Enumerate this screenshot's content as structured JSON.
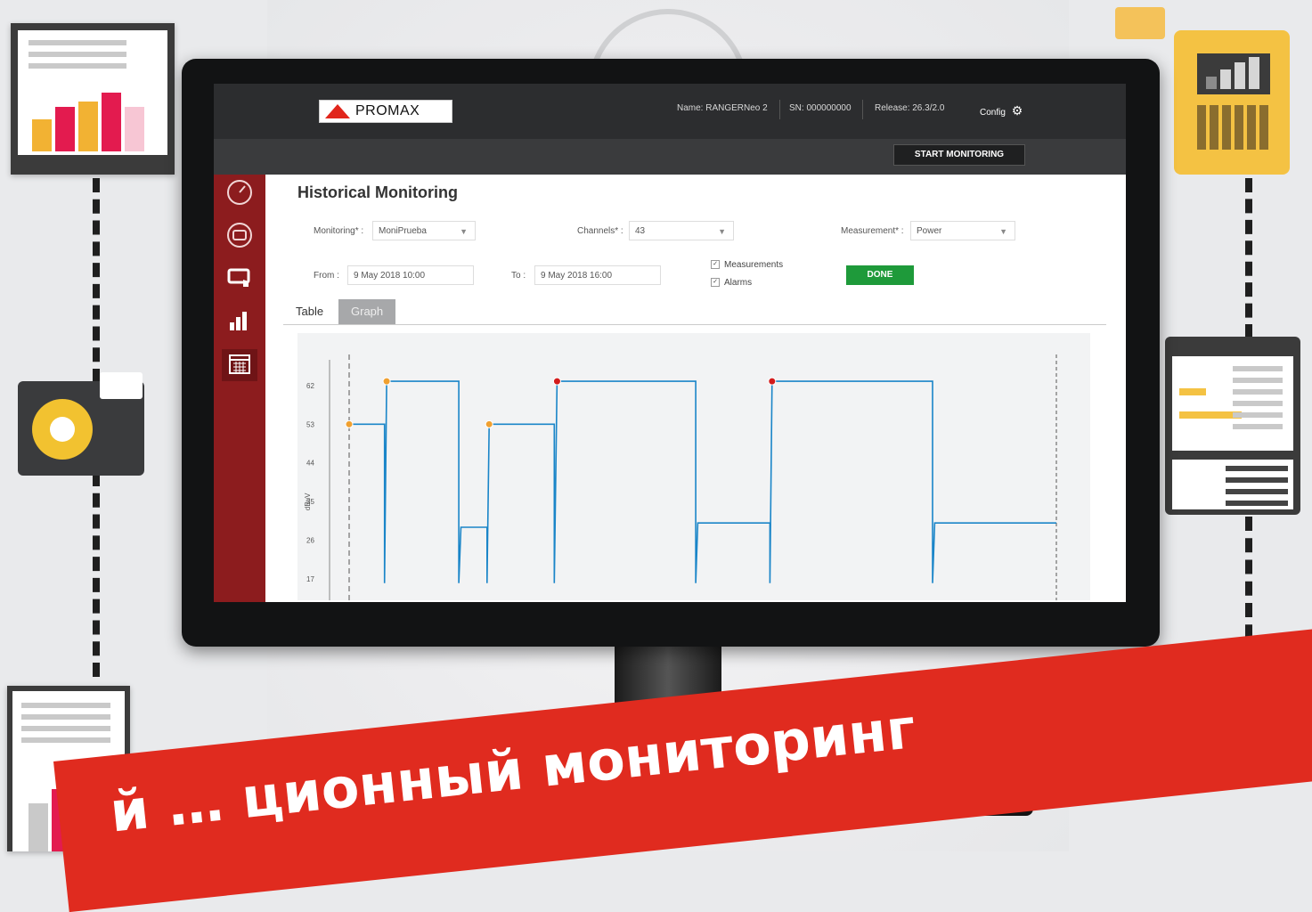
{
  "colors": {
    "brand_red": "#e02b1f",
    "sidebar_red": "#8c1c1e",
    "done_green": "#1e9a3a",
    "trace_blue": "#1a85c8"
  },
  "header": {
    "logo_text": "PROMAX",
    "device_name": "Name: RANGERNeo 2",
    "serial": "SN: 000000000",
    "release": "Release: 26.3/2.0",
    "config_label": "Config",
    "config_icon": "gear-icon"
  },
  "toolbar": {
    "start_monitoring": "START MONITORING"
  },
  "sidebar": {
    "items": [
      {
        "icon": "gauge-icon"
      },
      {
        "icon": "screen-icon"
      },
      {
        "icon": "monitor-touch-icon"
      },
      {
        "icon": "bar-chart-icon"
      },
      {
        "icon": "calendar-icon",
        "active": true
      }
    ]
  },
  "page": {
    "title": "Historical Monitoring"
  },
  "filters": {
    "monitoring_label": "Monitoring* :",
    "monitoring_value": "MoniPrueba",
    "channels_label": "Channels* :",
    "channels_value": "43",
    "measurement_label": "Measurement* :",
    "measurement_value": "Power",
    "from_label": "From :",
    "from_value": "9 May 2018 10:00",
    "to_label": "To :",
    "to_value": "9 May 2018 16:00",
    "measurements_check": "Measurements",
    "alarms_check": "Alarms",
    "done_label": "DONE"
  },
  "tabs": [
    {
      "label": "Table",
      "active": true
    },
    {
      "label": "Graph",
      "active": false
    }
  ],
  "chart_data": {
    "type": "line",
    "ylabel": "dBuV",
    "y_ticks": [
      62,
      53,
      44,
      35,
      26,
      17
    ],
    "ylim": [
      12,
      68
    ],
    "xlim": [
      0,
      100
    ],
    "series": [
      {
        "x": [
          0,
          5,
          5,
          5.3,
          5.3,
          15.5,
          15.5,
          15.8,
          15.8,
          19.5,
          19.5,
          19.8,
          19.8,
          29,
          29,
          29.4,
          29.4,
          49,
          49,
          49.3,
          49.3,
          59.5,
          59.5,
          59.8,
          59.8,
          82.5,
          82.5,
          82.8,
          82.8,
          100
        ],
        "y": [
          53,
          53,
          16,
          63,
          63,
          63,
          16,
          29,
          29,
          29,
          16,
          53,
          53,
          53,
          16,
          63,
          63,
          63,
          16,
          30,
          30,
          30,
          16,
          63,
          63,
          63,
          16,
          30,
          30,
          30
        ]
      }
    ],
    "markers": [
      {
        "x": 0,
        "y": 53,
        "color": "#f0a030"
      },
      {
        "x": 5.3,
        "y": 63,
        "color": "#f0a030"
      },
      {
        "x": 19.8,
        "y": 53,
        "color": "#f0a030"
      },
      {
        "x": 29.4,
        "y": 63,
        "color": "#d31b1b"
      },
      {
        "x": 59.8,
        "y": 63,
        "color": "#d31b1b"
      }
    ]
  },
  "banner": {
    "text": "й … ционный мониторинг"
  }
}
